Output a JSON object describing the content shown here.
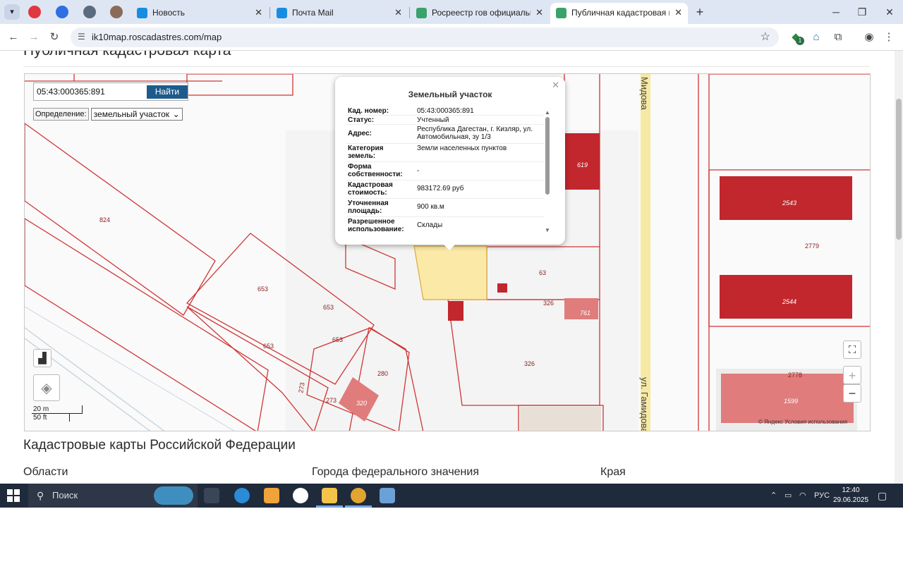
{
  "browser": {
    "tabs": [
      {
        "label": "Новость"
      },
      {
        "label": "Почта Mail"
      },
      {
        "label": "Росреестр гов официальный сайт"
      },
      {
        "label": "Публичная кадастровая карта",
        "active": true
      }
    ],
    "new_tab": "+",
    "url": "ik10map.roscadastres.com/map",
    "ext_badge": "1"
  },
  "page": {
    "title": "Публичная кадастровая карта",
    "search_value": "05:43:000365:891",
    "search_button": "Найти",
    "definition_label": "Определение:",
    "definition_value": "земельный участок",
    "scale_metric": "20 m",
    "scale_imperial": "50 ft",
    "yandex_terms": "© Яндекс Условия использования",
    "street_top": "Мидова",
    "street_bottom": "ул. Гамидова",
    "section_heading": "Кадастровые карты Российской Федерации",
    "col_regions": "Области",
    "col_cities": "Города федерального значения",
    "col_krai": "Края"
  },
  "parcels": {
    "p824": "824",
    "p653a": "653",
    "p653b": "653",
    "p653c": "653",
    "p653d": "653",
    "p273a": "273",
    "p273b": "273",
    "p280": "280",
    "p320": "320",
    "p63": "63",
    "p326a": "326",
    "p326b": "326",
    "p761": "761",
    "p619": "619",
    "p2543": "2543",
    "p2544": "2544",
    "p2779": "2779",
    "p2778": "2778",
    "p1599": "1599"
  },
  "popup": {
    "title": "Земельный участок",
    "rows": [
      {
        "k": "Кад. номер:",
        "v": "05:43:000365:891"
      },
      {
        "k": "Статус:",
        "v": "Учтенный"
      },
      {
        "k": "Адрес:",
        "v": "Республика Дагестан, г. Кизляр, ул. Автомобильная, зу 1/3"
      },
      {
        "k": "Категория земель:",
        "v": "Земли населенных пунктов"
      },
      {
        "k": "Форма собственности:",
        "v": "-"
      },
      {
        "k": "Кадастровая стоимость:",
        "v": "983172.69 руб"
      },
      {
        "k": "Уточненная площадь:",
        "v": "900 кв.м"
      },
      {
        "k": "Разрешенное использование:",
        "v": "Склады"
      }
    ]
  },
  "taskbar": {
    "search_placeholder": "Поиск",
    "lang": "РУС",
    "time": "12:40",
    "date": "29.06.2025"
  },
  "colors": {
    "accent": "#1d5b8c",
    "parcel_line": "#d03535",
    "building_fill": "#c1272d",
    "selected_parcel": "#fbe9a8"
  }
}
